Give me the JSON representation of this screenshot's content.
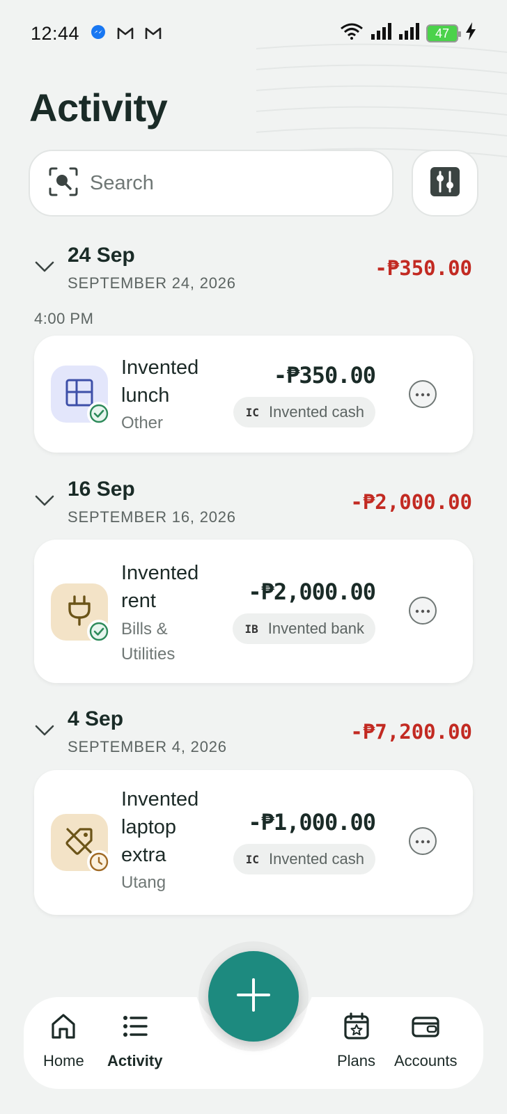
{
  "status_bar": {
    "time": "12:44",
    "battery": "47",
    "notification_icons": [
      "messenger-icon",
      "gmail-icon",
      "gmail-icon"
    ]
  },
  "page": {
    "title": "Activity"
  },
  "search": {
    "placeholder": "Search"
  },
  "groups": [
    {
      "day_label": "24 Sep",
      "date": "SEPTEMBER 24, 2026",
      "total": "-₱350.00",
      "time_label": "4:00 PM",
      "transactions": [
        {
          "name_line1": "Invented",
          "name_line2": "lunch",
          "category": "Other",
          "amount": "-₱350.00",
          "account_abbr": "IC",
          "account_name": "Invented cash",
          "icon": "layout-grid-icon",
          "status_icon": "check-circle-icon"
        }
      ]
    },
    {
      "day_label": "16 Sep",
      "date": "SEPTEMBER 16, 2026",
      "total": "-₱2,000.00",
      "transactions": [
        {
          "name_line1": "Invented",
          "name_line2": "rent",
          "category_line1": "Bills &",
          "category_line2": "Utilities",
          "amount": "-₱2,000.00",
          "account_abbr": "IB",
          "account_name": "Invented bank",
          "icon": "plug-icon",
          "status_icon": "check-circle-icon"
        }
      ]
    },
    {
      "day_label": "4 Sep",
      "date": "SEPTEMBER 4, 2026",
      "total": "-₱7,200.00",
      "transactions": [
        {
          "name_line1": "Invented",
          "name_line2": "laptop",
          "name_line3": "extra",
          "category": "Utang",
          "amount": "-₱1,000.00",
          "account_abbr": "IC",
          "account_name": "Invented cash",
          "icon": "tag-off-icon",
          "status_icon": "clock-icon"
        }
      ]
    }
  ],
  "nav": {
    "home": "Home",
    "activity": "Activity",
    "plans": "Plans",
    "accounts": "Accounts"
  },
  "colors": {
    "accent": "#1d8a7f",
    "negative": "#c22a22",
    "background": "#f1f3f2"
  }
}
